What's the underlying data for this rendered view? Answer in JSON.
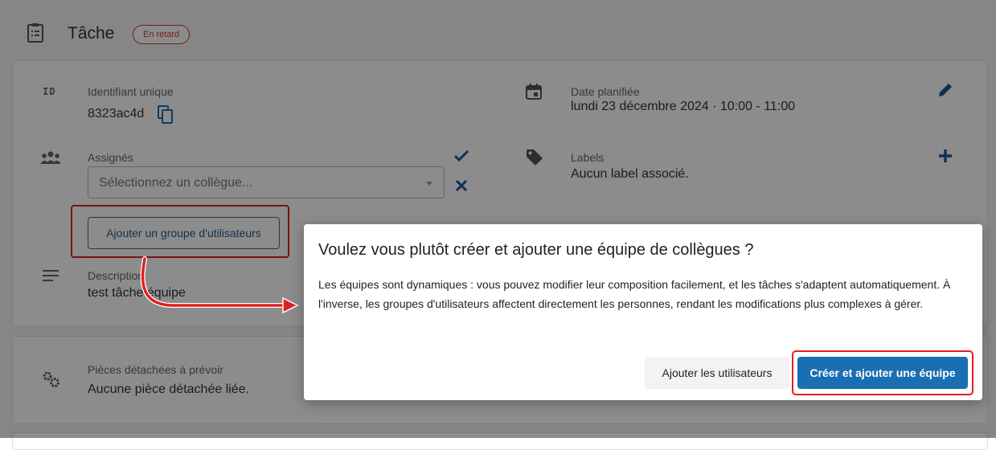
{
  "header": {
    "title": "Tâche",
    "status_badge": "En retard"
  },
  "fields": {
    "id": {
      "icon_text": "ID",
      "label": "Identifiant unique",
      "value": "8323ac4d"
    },
    "date": {
      "label": "Date planifiée",
      "value": "lundi 23 décembre 2024 · 10:00 - 11:00"
    },
    "assignees": {
      "label": "Assignés",
      "placeholder": "Sélectionnez un collègue..."
    },
    "labels": {
      "label": "Labels",
      "value": "Aucun label associé."
    },
    "description": {
      "label": "Description",
      "value": "test tâche équipe"
    },
    "parts": {
      "label": "Pièces détachées à prévoir",
      "value": "Aucune pièce détachée liée."
    }
  },
  "buttons": {
    "add_user_group": "Ajouter un groupe d'utilisateurs"
  },
  "modal": {
    "title": "Voulez vous plutôt créer et ajouter une équipe de collègues ?",
    "body": "Les équipes sont dynamiques : vous pouvez modifier leur composition facilement, et les tâches s'adaptent automatiquement. À l'inverse, les groupes d'utilisateurs affectent directement les personnes, rendant les modifications plus complexes à gérer.",
    "secondary_button": "Ajouter les utilisateurs",
    "primary_button": "Créer et ajouter une équipe"
  },
  "colors": {
    "primary": "#1a6fb3",
    "danger": "#d23a3a",
    "annotation": "#e02020"
  },
  "icons": [
    "clipboard-icon",
    "copy-icon",
    "calendar-icon",
    "edit-icon",
    "group-icon",
    "check-icon",
    "close-icon",
    "tag-icon",
    "plus-icon",
    "text-lines-icon",
    "gears-icon"
  ]
}
